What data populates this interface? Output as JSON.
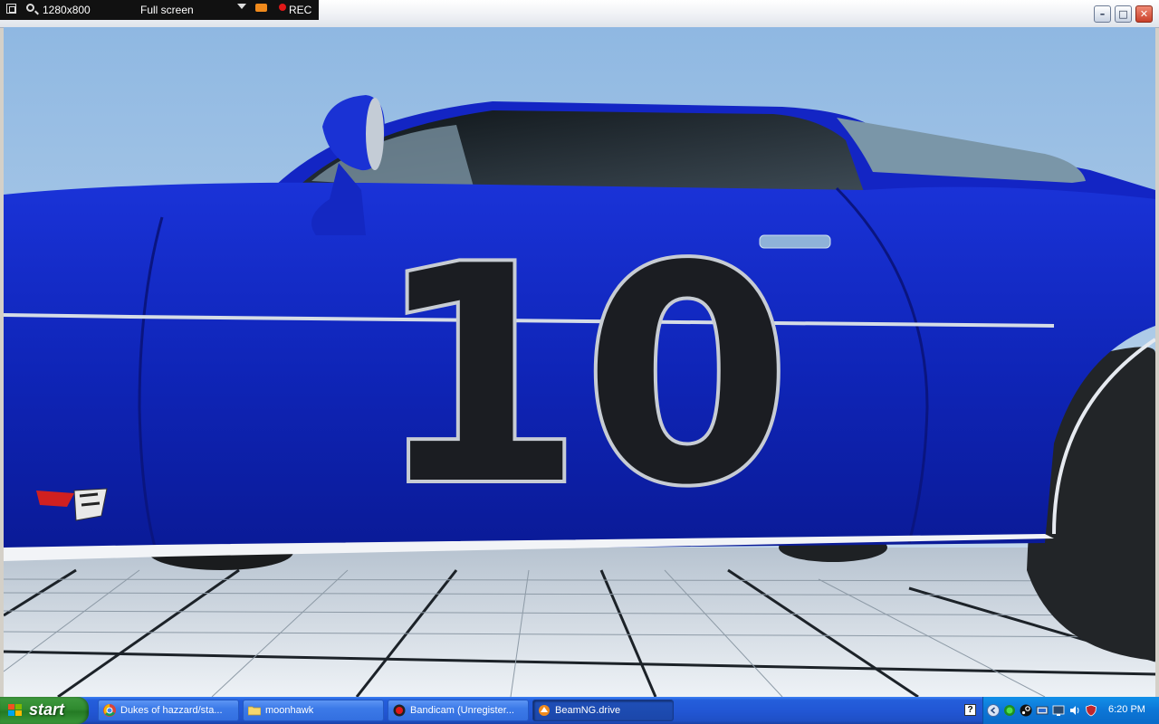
{
  "bandicam": {
    "size_label": "1280x800",
    "mode_label": "Full screen",
    "rec_label": "REC"
  },
  "window_controls": {
    "minimize_glyph": "–",
    "maximize_glyph": "□",
    "close_glyph": "✕"
  },
  "scene": {
    "car_number": "10",
    "car_color": "#1028c8",
    "sky_color": "#a9c8e6"
  },
  "taskbar": {
    "start_label": "start",
    "tasks": [
      {
        "label": "Dukes of hazzard/sta...",
        "icon": "chrome-icon"
      },
      {
        "label": "moonhawk",
        "icon": "folder-icon"
      },
      {
        "label": "Bandicam (Unregister...",
        "icon": "record-icon"
      },
      {
        "label": "BeamNG.drive",
        "icon": "beamng-icon"
      }
    ],
    "help_glyph": "?",
    "clock": "6:20 PM"
  }
}
